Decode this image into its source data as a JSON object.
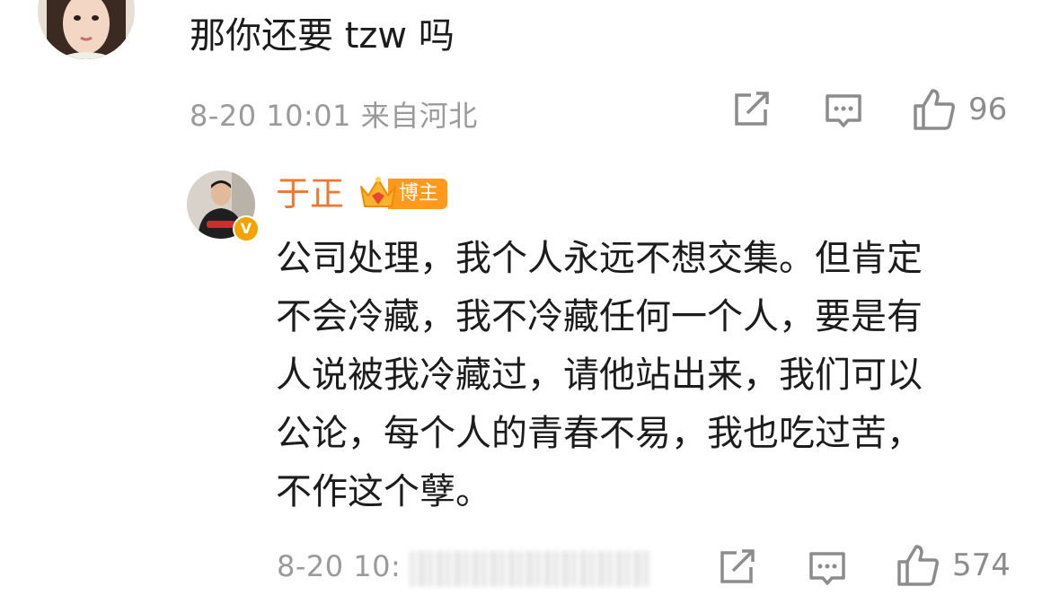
{
  "comment": {
    "text": "那你还要 tzw 吗",
    "timestamp": "8-20 10:01",
    "location": "来自河北",
    "like_count": "96",
    "icons": {
      "share": "share-icon",
      "reply": "comment-icon",
      "like": "thumbs-up-icon"
    }
  },
  "reply": {
    "username": "于正",
    "badge": "博主",
    "verified_mark": "V",
    "lines": [
      "公司处理，我个人永远不想交集。但肯定",
      "不会冷藏，我不冷藏任何一个人，要是有",
      "人说被我冷藏过，请他站出来，我们可以",
      "公论，每个人的青春不易，我也吃过苦，",
      "不作这个孽。"
    ],
    "timestamp_visible": "8-20 10:",
    "like_count": "574"
  },
  "colors": {
    "username": "#f0772f",
    "badge_bg": "#ff9a1f",
    "meta_text": "#9a9a9a",
    "icon": "#8c8c8c",
    "verified": "#f5a300"
  }
}
